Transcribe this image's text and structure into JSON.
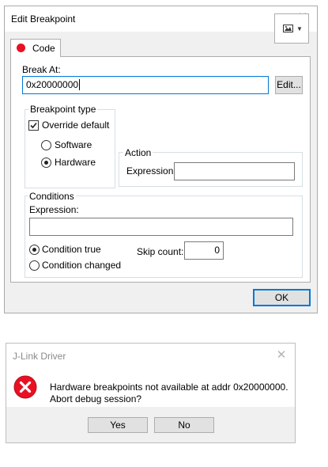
{
  "edit_breakpoint": {
    "title": "Edit Breakpoint",
    "close_glyph": "✕",
    "tab_label": "Code",
    "break_at_label": "Break At:",
    "break_at_value": "0x20000000",
    "edit_button": "Edit...",
    "breakpoint_type": {
      "legend": "Breakpoint type",
      "override_label": "Override default",
      "override_checked": true,
      "software_label": "Software",
      "hardware_label": "Hardware",
      "selected": "Hardware"
    },
    "action": {
      "legend": "Action",
      "expression_label": "Expression:",
      "expression_value": ""
    },
    "conditions": {
      "legend": "Conditions",
      "expression_label": "Expression:",
      "expression_value": "",
      "condition_true_label": "Condition true",
      "condition_changed_label": "Condition changed",
      "selected": "Condition true",
      "skip_count_label": "Skip count:",
      "skip_count_value": "0"
    },
    "ok_button": "OK",
    "tab_dot_color": "#e81123",
    "accent_color": "#0078d7"
  },
  "jlink_dialog": {
    "title": "J-Link Driver",
    "close_glyph": "✕",
    "icon": "error-icon",
    "message_line1": "Hardware breakpoints not available at addr 0x20000000.",
    "message_line2": "Abort debug session?",
    "yes_button": "Yes",
    "no_button": "No",
    "error_color": "#e81123"
  }
}
